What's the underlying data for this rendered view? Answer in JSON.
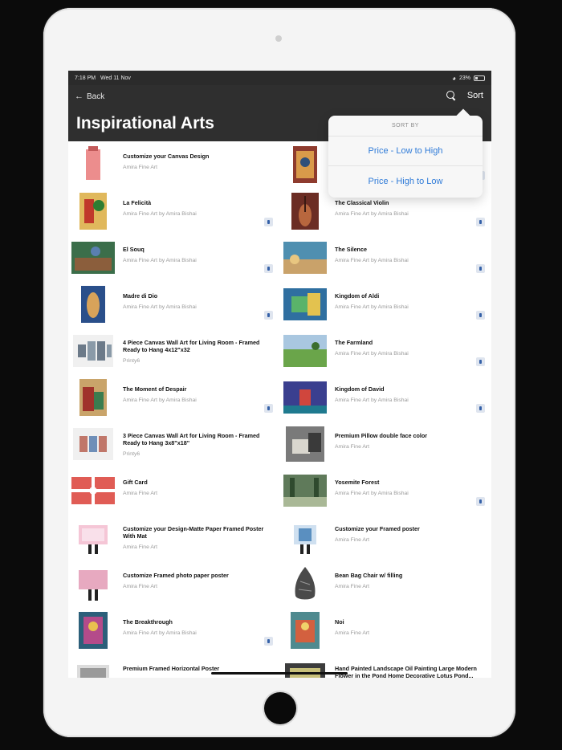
{
  "status": {
    "time": "7:18 PM",
    "date": "Wed 11 Nov",
    "battery": "23%"
  },
  "nav": {
    "back_label": "Back",
    "sort_label": "Sort",
    "title": "Inspirational Arts"
  },
  "sort_menu": {
    "header": "SORT BY",
    "options": [
      "Price - Low to High",
      "Price - High to Low"
    ]
  },
  "left_items": [
    {
      "title": "Customize your Canvas Design",
      "subtitle": "Amira Fine Art",
      "badge": false
    },
    {
      "title": "La Felicità",
      "subtitle": "Amira Fine Art by Amira Bishai",
      "badge": true
    },
    {
      "title": "El Souq",
      "subtitle": "Amira Fine Art by Amira Bishai",
      "badge": true
    },
    {
      "title": "Madre di Dio",
      "subtitle": "Amira Fine Art by Amira Bishai",
      "badge": true
    },
    {
      "title": "4 Piece Canvas Wall Art for Living Room - Framed Ready to Hang 4x12\"x32",
      "subtitle": "Printy6",
      "badge": false
    },
    {
      "title": "The Moment of Despair",
      "subtitle": "Amira Fine Art by Amira Bishai",
      "badge": true
    },
    {
      "title": "3 Piece Canvas Wall Art for Living Room - Framed Ready to Hang 3x8\"x18\"",
      "subtitle": "Printy6",
      "badge": false
    },
    {
      "title": "Gift Card",
      "subtitle": "Amira Fine Art",
      "badge": false
    },
    {
      "title": "Customize your Design-Matte Paper Framed Poster With Mat",
      "subtitle": "Amira Fine Art",
      "badge": false
    },
    {
      "title": "Customize Framed photo paper poster",
      "subtitle": "Amira Fine Art",
      "badge": false
    },
    {
      "title": "The Breakthrough",
      "subtitle": "Amira Fine Art by Amira Bishai",
      "badge": true
    },
    {
      "title": "Premium Framed Horizontal Poster",
      "subtitle": "",
      "badge": false
    }
  ],
  "right_items": [
    {
      "title": "",
      "subtitle": "",
      "badge": true
    },
    {
      "title": "The Classical Violin",
      "subtitle": "Amira Fine Art by Amira Bishai",
      "badge": true
    },
    {
      "title": "The Silence",
      "subtitle": "Amira Fine Art by Amira Bishai",
      "badge": true
    },
    {
      "title": "Kingdom of Aldi",
      "subtitle": "Amira Fine Art by Amira Bishai",
      "badge": true
    },
    {
      "title": "The Farmland",
      "subtitle": "Amira Fine Art by Amira Bishai",
      "badge": true
    },
    {
      "title": "Kingdom of David",
      "subtitle": "Amira Fine Art by Amira Bishai",
      "badge": true
    },
    {
      "title": "Premium Pillow double face color",
      "subtitle": "Amira Fine Art",
      "badge": false
    },
    {
      "title": "Yosemite Forest",
      "subtitle": "Amira Fine Art by Amira Bishai",
      "badge": true
    },
    {
      "title": "Customize your Framed poster",
      "subtitle": "Amira Fine Art",
      "badge": false
    },
    {
      "title": "Bean Bag Chair w/ filling",
      "subtitle": "Amira Fine Art",
      "badge": false
    },
    {
      "title": "Noi",
      "subtitle": "Amira Fine Art",
      "badge": false
    },
    {
      "title": "Hand Painted Landscape Oil Painting Large Modern Flower in the Pond Home Decorative Lotus Pond...",
      "subtitle": "",
      "badge": false
    }
  ],
  "colors": {
    "nav_bg": "#2f2f2f",
    "accent": "#2f7bd8",
    "badge": "#3561a8"
  }
}
